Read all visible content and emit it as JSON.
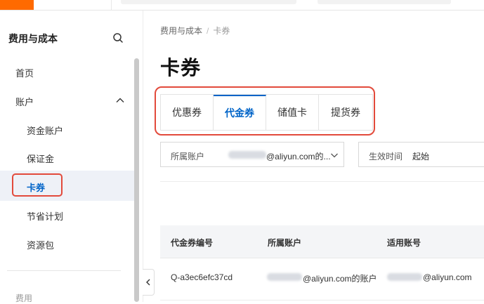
{
  "sidebar": {
    "title": "费用与成本",
    "items": [
      {
        "label": "首页"
      },
      {
        "label": "账户"
      },
      {
        "label": "资金账户"
      },
      {
        "label": "保证金"
      },
      {
        "label": "卡券"
      },
      {
        "label": "节省计划"
      },
      {
        "label": "资源包"
      }
    ],
    "group_label": "费用"
  },
  "breadcrumb": {
    "root": "费用与成本",
    "separator": "/",
    "current": "卡券"
  },
  "page": {
    "title": "卡券"
  },
  "tabs": [
    {
      "label": "优惠券",
      "active": false
    },
    {
      "label": "代金券",
      "active": true
    },
    {
      "label": "储值卡",
      "active": false
    },
    {
      "label": "提货券",
      "active": false
    }
  ],
  "filters": {
    "account_label": "所属账户",
    "account_value": "@aliyun.com的...",
    "time_label": "生效时间",
    "time_value": "起始"
  },
  "table": {
    "columns": [
      "代金券编号",
      "所属账户",
      "适用账号"
    ],
    "rows": [
      {
        "id": "Q-a3ec6efc37cd",
        "account": "@aliyun.com的账户",
        "applicable": "@aliyun.com"
      }
    ]
  },
  "colors": {
    "accent": "#0064c8",
    "highlight": "#e24a3b",
    "brand": "#ff6a00"
  }
}
